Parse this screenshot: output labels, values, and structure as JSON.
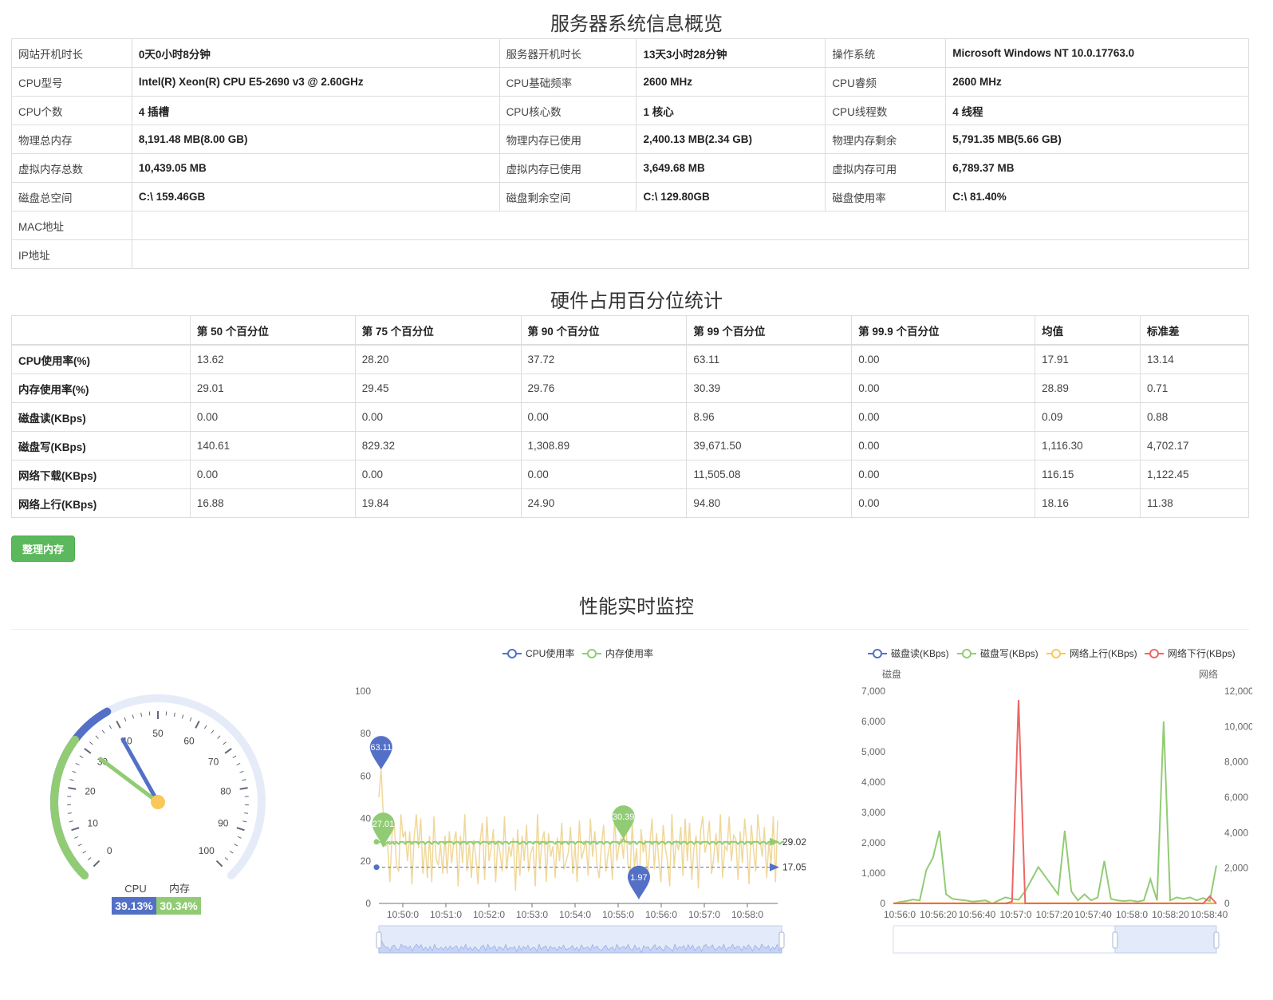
{
  "titles": {
    "overview": "服务器系统信息概览",
    "percentile": "硬件占用百分位统计",
    "realtime": "性能实时监控"
  },
  "info_rows": [
    {
      "type": "triple",
      "cells": [
        [
          "网站开机时长",
          "0天0小时8分钟"
        ],
        [
          "服务器开机时长",
          "13天3小时28分钟"
        ],
        [
          "操作系统",
          "Microsoft Windows NT 10.0.17763.0"
        ]
      ]
    },
    {
      "type": "triple",
      "cells": [
        [
          "CPU型号",
          "Intel(R) Xeon(R) CPU E5-2690 v3 @ 2.60GHz"
        ],
        [
          "CPU基础频率",
          "2600 MHz"
        ],
        [
          "CPU睿频",
          "2600 MHz"
        ]
      ]
    },
    {
      "type": "triple",
      "cells": [
        [
          "CPU个数",
          "4 插槽"
        ],
        [
          "CPU核心数",
          "1 核心"
        ],
        [
          "CPU线程数",
          "4 线程"
        ]
      ]
    },
    {
      "type": "triple",
      "cells": [
        [
          "物理总内存",
          "8,191.48 MB(8.00 GB)"
        ],
        [
          "物理内存已使用",
          "2,400.13 MB(2.34 GB)"
        ],
        [
          "物理内存剩余",
          "5,791.35 MB(5.66 GB)"
        ]
      ]
    },
    {
      "type": "triple",
      "cells": [
        [
          "虚拟内存总数",
          "10,439.05 MB"
        ],
        [
          "虚拟内存已使用",
          "3,649.68 MB"
        ],
        [
          "虚拟内存可用",
          "6,789.37 MB"
        ]
      ]
    },
    {
      "type": "triple",
      "cells": [
        [
          "磁盘总空间",
          "C:\\ 159.46GB"
        ],
        [
          "磁盘剩余空间",
          "C:\\ 129.80GB"
        ],
        [
          "磁盘使用率",
          "C:\\ 81.40%"
        ]
      ]
    },
    {
      "type": "single",
      "cells": [
        [
          "MAC地址",
          ""
        ]
      ]
    },
    {
      "type": "single",
      "cells": [
        [
          "IP地址",
          ""
        ]
      ]
    }
  ],
  "percentile_table": {
    "headers": [
      "",
      "第 50 个百分位",
      "第 75 个百分位",
      "第 90 个百分位",
      "第 99 个百分位",
      "第 99.9 个百分位",
      "均值",
      "标准差"
    ],
    "rows": [
      [
        "CPU使用率(%)",
        "13.62",
        "28.20",
        "37.72",
        "63.11",
        "0.00",
        "17.91",
        "13.14"
      ],
      [
        "内存使用率(%)",
        "29.01",
        "29.45",
        "29.76",
        "30.39",
        "0.00",
        "28.89",
        "0.71"
      ],
      [
        "磁盘读(KBps)",
        "0.00",
        "0.00",
        "0.00",
        "8.96",
        "0.00",
        "0.09",
        "0.88"
      ],
      [
        "磁盘写(KBps)",
        "140.61",
        "829.32",
        "1,308.89",
        "39,671.50",
        "0.00",
        "1,116.30",
        "4,702.17"
      ],
      [
        "网络下载(KBps)",
        "0.00",
        "0.00",
        "0.00",
        "11,505.08",
        "0.00",
        "116.15",
        "1,122.45"
      ],
      [
        "网络上行(KBps)",
        "16.88",
        "19.84",
        "24.90",
        "94.80",
        "0.00",
        "18.16",
        "11.38"
      ]
    ]
  },
  "buttons": {
    "clean_memory": "整理内存"
  },
  "colors": {
    "cpu": "#5470c6",
    "mem": "#91cc75",
    "up": "#fac858",
    "down": "#ee6666",
    "pointer_center": "#fac858",
    "gauge_track": "#e6ebf8"
  },
  "chart_data": [
    {
      "type": "gauge",
      "min": 0,
      "max": 100,
      "ticks": [
        "0",
        "10",
        "20",
        "30",
        "40",
        "50",
        "60",
        "70",
        "80",
        "90",
        "100"
      ],
      "series": [
        {
          "name": "CPU",
          "value": 39.13,
          "label": "39.13%"
        },
        {
          "name": "内存",
          "value": 30.34,
          "label": "30.34%"
        }
      ]
    },
    {
      "type": "line",
      "legend": [
        "CPU使用率",
        "内存使用率"
      ],
      "ylim": [
        0,
        100
      ],
      "yticks": [
        "0",
        "20",
        "40",
        "60",
        "80",
        "100"
      ],
      "xticks": [
        "10:50:0",
        "10:51:0",
        "10:52:0",
        "10:53:0",
        "10:54:0",
        "10:55:0",
        "10:56:0",
        "10:57:0",
        "10:58:0"
      ],
      "series": [
        {
          "name": "CPU使用率",
          "values": [
            50,
            63.11,
            42,
            27,
            28,
            10,
            33,
            38,
            18,
            15,
            42,
            31,
            34,
            20,
            34,
            9,
            31,
            42,
            26,
            40,
            14,
            29,
            12,
            32,
            10,
            41,
            21,
            18,
            28,
            14,
            32,
            14,
            34,
            19,
            29,
            34,
            8,
            32,
            19,
            42,
            15,
            28,
            12,
            30,
            22,
            9,
            30,
            38,
            11,
            41,
            20,
            26,
            35,
            10,
            30,
            24,
            15,
            41,
            16,
            27,
            22,
            31,
            6,
            35,
            13,
            32,
            20,
            37,
            15,
            24,
            27,
            8,
            42,
            16,
            29,
            34,
            10,
            33,
            22,
            27,
            12,
            31,
            20,
            38,
            16,
            20,
            24,
            36,
            14,
            28,
            10,
            39,
            21,
            25,
            30,
            13,
            40,
            22,
            34,
            18,
            12,
            27,
            37,
            15,
            23,
            29,
            11,
            42,
            20,
            27,
            31,
            21,
            41,
            19,
            13,
            38,
            17,
            26,
            1.97,
            35,
            24,
            30,
            12,
            28,
            40,
            16,
            33,
            21,
            10,
            37,
            26,
            20,
            8,
            42,
            17,
            30,
            25,
            36,
            13,
            40,
            20,
            38,
            11,
            26,
            32,
            7,
            34,
            41,
            24,
            29,
            39,
            14,
            22,
            33,
            19,
            42,
            12,
            27,
            25,
            41,
            20,
            32,
            30.39,
            11,
            34,
            19,
            40,
            28,
            9,
            37,
            26,
            15,
            42,
            30,
            22,
            36,
            12,
            29,
            18,
            41,
            10,
            39
          ]
        },
        {
          "name": "内存使用率",
          "values": [
            29,
            29,
            27.01,
            28,
            29,
            28,
            29,
            28,
            29,
            28,
            29,
            29,
            28,
            29,
            29,
            28,
            29,
            29,
            28,
            29,
            29,
            28,
            29,
            29,
            28,
            29,
            29,
            28,
            29,
            29,
            28,
            29,
            29,
            29,
            28,
            29,
            29,
            28,
            29,
            29,
            28,
            29,
            29,
            28,
            29,
            29,
            28,
            29,
            29,
            29,
            28,
            29,
            29,
            28,
            29,
            29,
            28,
            29,
            29,
            28,
            29,
            29,
            29,
            29,
            28,
            29,
            29,
            28,
            29,
            29,
            28,
            29,
            29,
            28,
            29,
            29,
            28,
            29,
            29,
            29,
            28,
            29,
            29,
            28,
            29,
            29,
            28,
            29,
            29,
            28,
            29,
            29,
            29,
            28,
            29,
            29,
            28,
            29,
            29,
            28,
            29,
            29,
            28,
            29,
            29,
            28,
            29,
            29,
            29,
            28,
            29,
            30.39,
            29,
            29,
            28,
            29,
            29,
            28,
            29,
            29,
            28,
            29,
            29,
            29,
            28,
            29,
            29,
            28,
            29,
            29,
            28,
            29,
            29,
            28,
            29,
            29,
            29,
            28,
            29,
            29,
            28,
            29,
            29,
            28,
            29,
            29,
            28,
            29,
            29,
            29,
            28,
            29,
            29,
            28,
            29,
            29,
            28,
            29,
            29,
            28,
            29,
            29,
            29,
            28,
            29,
            29,
            28,
            29,
            29,
            28,
            29,
            29,
            29,
            28,
            29,
            29,
            28,
            29,
            29,
            28,
            29,
            29,
            28,
            29,
            29
          ]
        }
      ],
      "mark_points": [
        {
          "series": "CPU使用率",
          "label": "63.11",
          "kind": "max"
        },
        {
          "series": "CPU使用率",
          "label": "1.97",
          "kind": "min"
        },
        {
          "series": "内存使用率",
          "label": "27.01",
          "kind": "min"
        },
        {
          "series": "内存使用率",
          "label": "30.39",
          "kind": "max"
        }
      ],
      "mark_lines": [
        {
          "series": "内存使用率",
          "label": "29.02",
          "value": 29.02
        },
        {
          "series": "CPU使用率",
          "label": "17.05",
          "value": 17.05
        }
      ]
    },
    {
      "type": "line",
      "legend": [
        "磁盘读(KBps)",
        "磁盘写(KBps)",
        "网络上行(KBps)",
        "网络下行(KBps)"
      ],
      "left_axis": {
        "name": "磁盘",
        "ylim": [
          0,
          7000
        ],
        "yticks": [
          "0",
          "1,000",
          "2,000",
          "3,000",
          "4,000",
          "5,000",
          "6,000",
          "7,000"
        ]
      },
      "right_axis": {
        "name": "网络",
        "ylim": [
          0,
          12000
        ],
        "yticks": [
          "0",
          "2,000",
          "4,000",
          "6,000",
          "8,000",
          "10,000",
          "12,000"
        ]
      },
      "xticks": [
        "10:56:0",
        "10:56:20",
        "10:56:40",
        "10:57:0",
        "10:57:20",
        "10:57:40",
        "10:58:0",
        "10:58:20",
        "10:58:40"
      ],
      "series": [
        {
          "name": "磁盘读(KBps)",
          "axis": "left",
          "values": [
            0,
            0,
            0,
            0,
            0,
            0,
            0,
            0,
            0,
            0,
            0,
            0,
            0,
            0,
            0,
            0,
            0,
            0,
            0,
            0,
            0,
            0,
            0,
            0,
            0,
            0,
            0,
            0,
            0,
            0,
            0,
            0,
            0,
            0,
            0,
            0,
            0,
            0,
            0,
            0,
            0,
            0,
            0,
            0,
            0,
            0,
            0,
            0,
            0,
            0
          ]
        },
        {
          "name": "磁盘写(KBps)",
          "axis": "left",
          "values": [
            0,
            50,
            80,
            130,
            100,
            1100,
            1500,
            2400,
            300,
            150,
            120,
            100,
            60,
            80,
            100,
            0,
            100,
            200,
            150,
            120,
            400,
            800,
            1200,
            900,
            600,
            300,
            2400,
            400,
            100,
            300,
            100,
            200,
            1400,
            150,
            100,
            80,
            100,
            60,
            100,
            800,
            100,
            6000,
            100,
            200,
            150,
            200,
            100,
            180,
            80,
            1250
          ]
        },
        {
          "name": "网络上行(KBps)",
          "axis": "right",
          "values": [
            20,
            20,
            20,
            20,
            20,
            20,
            20,
            20,
            20,
            20,
            20,
            20,
            20,
            20,
            20,
            20,
            20,
            20,
            20,
            20,
            20,
            20,
            20,
            20,
            20,
            20,
            20,
            20,
            20,
            20,
            20,
            20,
            20,
            20,
            20,
            20,
            20,
            20,
            20,
            20,
            20,
            20,
            20,
            20,
            20,
            20,
            20,
            20,
            20,
            20
          ]
        },
        {
          "name": "网络下行(KBps)",
          "axis": "right",
          "values": [
            0,
            0,
            0,
            0,
            0,
            0,
            0,
            0,
            0,
            0,
            0,
            0,
            0,
            0,
            0,
            0,
            0,
            0,
            100,
            11500,
            0,
            0,
            0,
            0,
            0,
            0,
            0,
            0,
            0,
            0,
            0,
            0,
            0,
            0,
            0,
            0,
            0,
            0,
            0,
            0,
            0,
            0,
            0,
            0,
            0,
            0,
            0,
            0,
            400,
            0
          ]
        }
      ]
    }
  ]
}
